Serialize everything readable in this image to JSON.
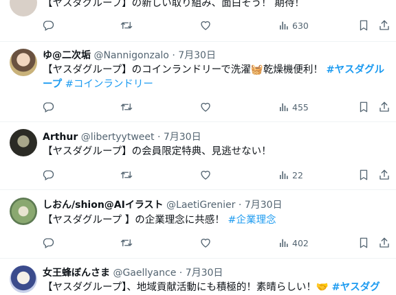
{
  "tweets": [
    {
      "text_parts": [
        "【ヤスダグループ】の新しい取り組み、面白そう！ 期待！"
      ],
      "views": "630"
    },
    {
      "name": "ゆ@二次垢",
      "handle": "@Nannigonzalo",
      "date": "7月30日",
      "line1_text": "【ヤスダグループ】のコインランドリーで洗濯",
      "line1_emoji": "🧺",
      "line1_text2": "乾燥機便利！",
      "line1_tag": "#ヤスダグル",
      "line2_tag": "ープ",
      "line2_tag2": "#コインランドリー",
      "views": "455"
    },
    {
      "name": "Arthur",
      "handle": "@libertyytweet",
      "date": "7月30日",
      "text": "【ヤスダグループ】の会員限定特典、見逃せない！",
      "views": "22"
    },
    {
      "name": "しおん/shion@AIイラスト",
      "handle": "@LaetiGrenier",
      "date": "7月30日",
      "text": "【ヤスダグループ 】の企業理念に共感！",
      "tag": "#企業理念",
      "views": "402"
    },
    {
      "name": "女王蜂ぼんさま",
      "handle": "@Gaellyance",
      "date": "7月30日",
      "text": "【ヤスダグループ】、地域貢献活動にも積極的！素晴らしい！",
      "emoji": "🤝",
      "tag": "#ヤスダグ"
    }
  ],
  "dot": "·",
  "icons": [
    "reply-icon",
    "retweet-icon",
    "like-icon",
    "views-icon",
    "bookmark-icon",
    "share-icon"
  ],
  "colors": {
    "link": "#1d9bf0",
    "muted": "#536471",
    "text": "#0f1419",
    "divider": "#eff3f4"
  }
}
